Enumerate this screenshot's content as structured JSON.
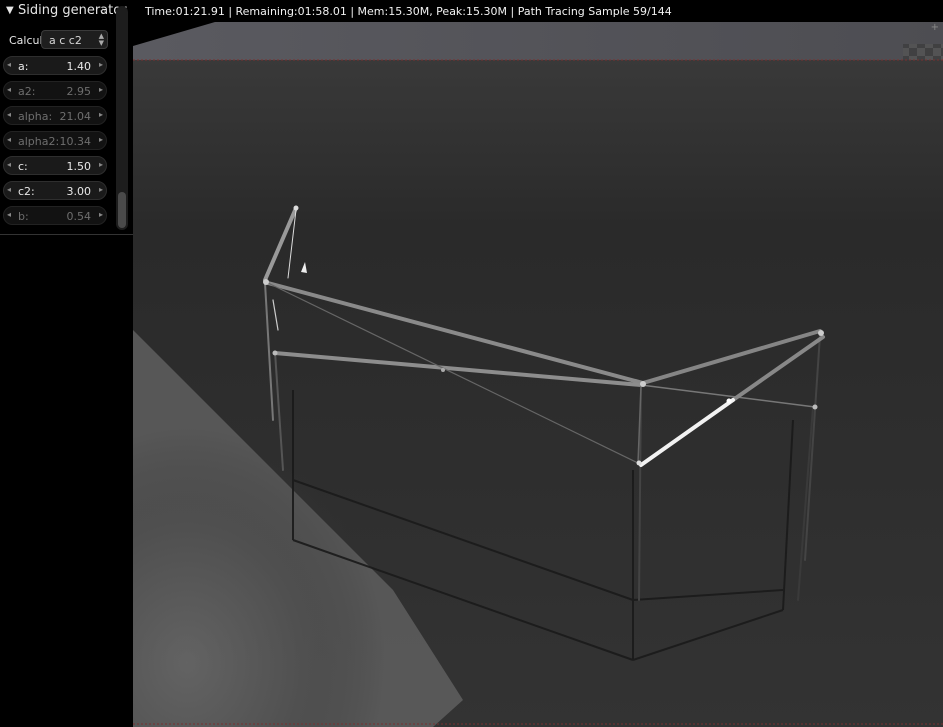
{
  "panel": {
    "title": "Siding generator",
    "calc_label": "Calcul",
    "calc_value": "a c c2",
    "fields": [
      {
        "label": "a:",
        "value": "1.40",
        "enabled": true
      },
      {
        "label": "a2:",
        "value": "2.95",
        "enabled": false
      },
      {
        "label": "alpha:",
        "value": "21.04",
        "enabled": false
      },
      {
        "label": "alpha2:",
        "value": "10.34",
        "enabled": false
      },
      {
        "label": "c:",
        "value": "1.50",
        "enabled": true
      },
      {
        "label": "c2:",
        "value": "3.00",
        "enabled": true
      },
      {
        "label": "b:",
        "value": "0.54",
        "enabled": false
      }
    ]
  },
  "viewport": {
    "header": "Time:01:21.91 | Remaining:01:58.01 | Mem:15.30M, Peak:15.30M | Path Tracing Sample 59/144"
  },
  "icons": {
    "panel_collapse": "triangle-down-icon",
    "panel_grip": "drag-grip-icon",
    "field_arrows": "arrow-left-right-icons",
    "select_arrows": "up-down-arrows-icon",
    "viewport_corner": "plus-icon"
  }
}
